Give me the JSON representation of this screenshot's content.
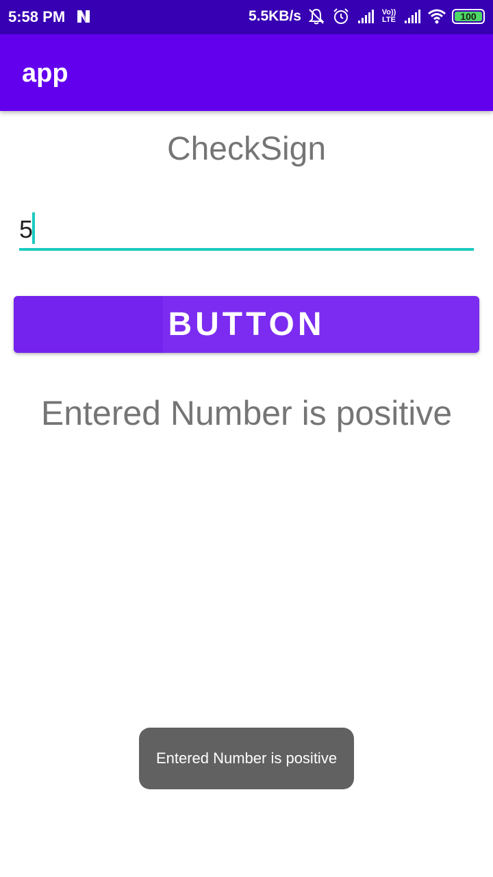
{
  "status_bar": {
    "time": "5:58 PM",
    "net_speed": "5.5KB/s",
    "network_type_top": "Vo))",
    "network_type_bottom": "LTE",
    "battery": "100",
    "icons": [
      "notification-n-icon",
      "mute-bell-icon",
      "alarm-icon",
      "signal-icon",
      "signal-icon",
      "wifi-icon",
      "battery-icon"
    ],
    "battery_color": "#4CD964",
    "background": "#3700B3"
  },
  "app_bar": {
    "title": "app",
    "background": "#6200EE"
  },
  "main": {
    "heading": "CheckSign",
    "input_value": "5",
    "accent_color": "#1ACBC0",
    "button_label": "BUTTON",
    "button_color": "#7B2CF0",
    "result": "Entered Number is positive"
  },
  "toast": {
    "message": "Entered Number is positive"
  }
}
